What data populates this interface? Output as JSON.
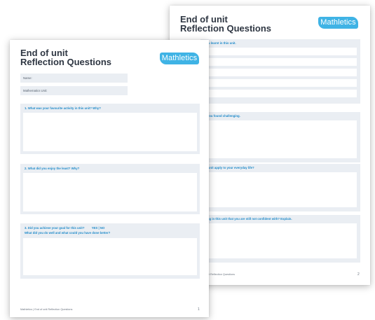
{
  "brand": {
    "logo_text": "Mathletics",
    "logo_color": "#3fb3e5",
    "heading_color": "#1f8ac9"
  },
  "page2": {
    "title_line1": "End of unit",
    "title_line2": "Reflection Questions",
    "q_learnt": "you learnt in this unit.",
    "q_challenging": "g you found challenging.",
    "q_everyday": "is unit apply to your everyday life?",
    "q_confident": "hing in this unit that you are still not confident with? Explain.",
    "footer": "it Reflection Questions",
    "page_number": "2"
  },
  "page1": {
    "title_line1": "End of unit",
    "title_line2": "Reflection Questions",
    "name_label": "Name:",
    "unit_label": "Mathematics Unit:",
    "q1": "1. What was your favourite activity in this unit? Why?",
    "q2": "2. What did you enjoy the least? Why?",
    "q3": "3. Did you achieve your goal for this unit?",
    "q3_yes_no": "YES | NO",
    "q3_followup": "What did you do well and what could you have done better?",
    "footer": "Mathletics | End of unit Reflection Questions",
    "page_number": "1"
  }
}
